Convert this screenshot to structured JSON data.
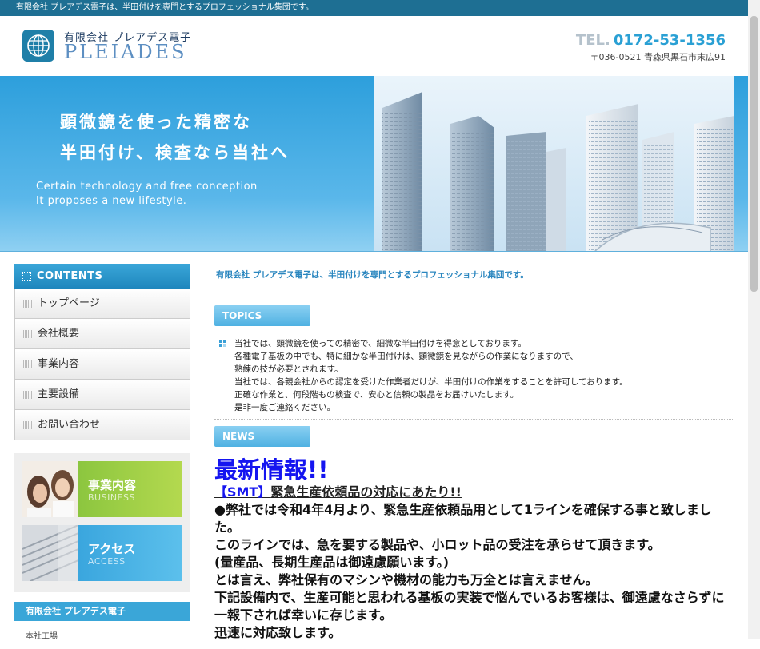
{
  "topbar": {
    "text": "有限会社 プレアデス電子は、半田付けを専門とするプロフェッショナル集団です。"
  },
  "header": {
    "company_jp": "有限会社 プレアデス電子",
    "company_en": "PLEIADES",
    "tel_label": "TEL.",
    "tel_number": "0172-53-1356",
    "address": "〒036-0521 青森県黒石市末広91"
  },
  "hero": {
    "copy_line1": "顕微鏡を使った精密な",
    "copy_line2": "半田付け、検査なら当社へ",
    "en_line1": "Certain technology and free conception",
    "en_line2": "It proposes a new lifestyle."
  },
  "sidebar": {
    "contents_heading": "CONTENTS",
    "items": [
      {
        "label": "トップページ"
      },
      {
        "label": "会社概要"
      },
      {
        "label": "事業内容"
      },
      {
        "label": "主要設備"
      },
      {
        "label": "お問い合わせ"
      }
    ],
    "banners": [
      {
        "jp": "事業内容",
        "en": "BUSINESS"
      },
      {
        "jp": "アクセス",
        "en": "ACCESS"
      }
    ],
    "company_heading": "有限会社 プレアデス電子",
    "company_line": "本社工場"
  },
  "main": {
    "intro": "有限会社 プレアデス電子は、半田付けを専門とするプロフェッショナル集団です。",
    "topics_label": "TOPICS",
    "topics_lines": [
      "当社では、顕微鏡を使っての精密で、細微な半田付けを得意としております。",
      "各種電子基板の中でも、特に細かな半田付けは、顕微鏡を見ながらの作業になりますので、",
      "熟練の技が必要とされます。",
      "当社では、各親会社からの認定を受けた作業者だけが、半田付けの作業をすることを許可しております。",
      "正確な作業と、何段階もの検査で、安心と信頼の製品をお届けいたします。",
      "是非一度ご連絡ください。"
    ],
    "news_label": "NEWS",
    "news_title": "最新情報!!",
    "news_sub_tag": "【SMT】",
    "news_sub_text": "緊急生産依頼品の対応にあたり!!",
    "news_lines": [
      "●弊社では令和4年4月より、緊急生産依頼品用として1ラインを確保する事と致しました。",
      "このラインでは、急を要する製品や、小ロット品の受注を承らせて頂きます。",
      "(量産品、長期生産品は御遠慮願います。)",
      "とは言え、弊社保有のマシンや機材の能力も万全とは言えません。",
      "下記設備内で、生産可能と思われる基板の実装で悩んでいるお客様は、御遠慮なさらずに一報下されば幸いに存じます。",
      "迅速に対応致します。"
    ]
  }
}
